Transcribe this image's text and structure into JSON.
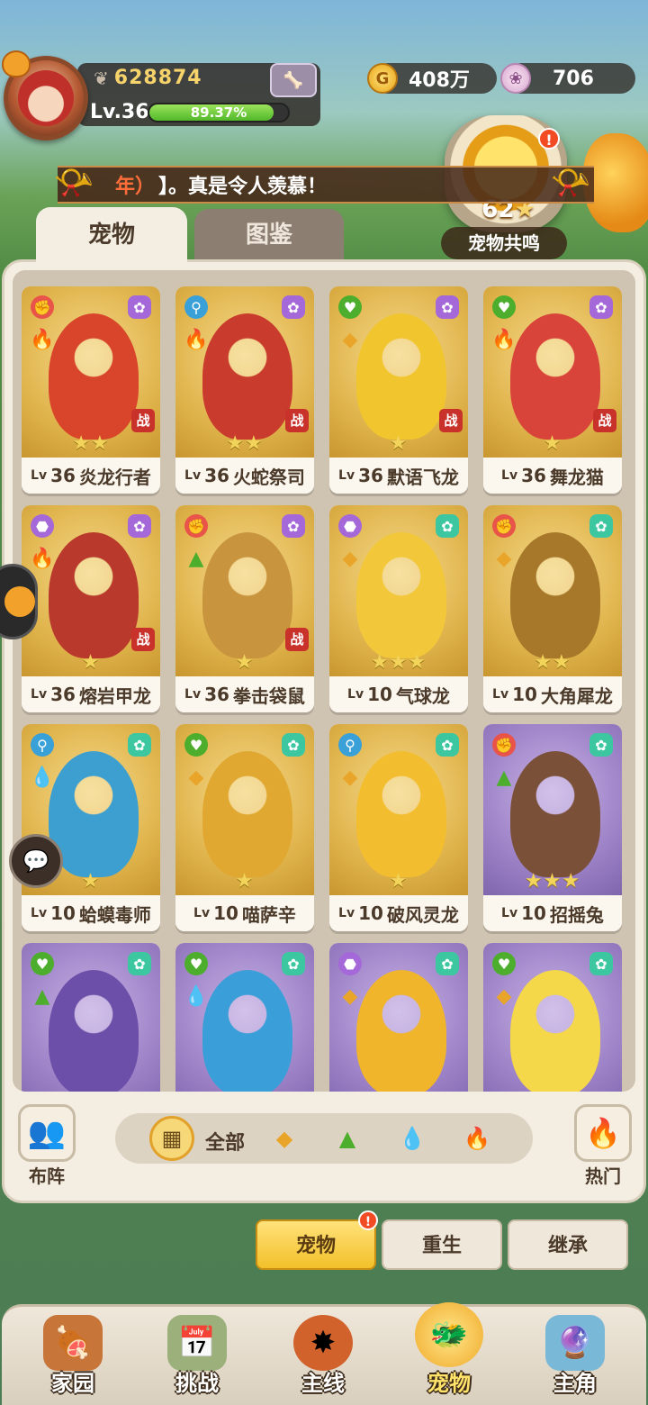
{
  "player": {
    "combat_power": "628874",
    "level": "Lv.36",
    "exp_percent": "89.37%",
    "exp_fraction": 0.8937
  },
  "currency": {
    "gold": "408万",
    "shells": "706"
  },
  "broadcast": {
    "highlight": "年）",
    "message": "】。真是令人羡慕！"
  },
  "resonance": {
    "badge": "!",
    "value": "62",
    "star": "★",
    "label": "宠物共鸣"
  },
  "tabs": {
    "pets": "宠物",
    "codex": "图鉴"
  },
  "pets": [
    {
      "level": "36",
      "name": "炎龙行者",
      "stars": "★★",
      "rarity": "gold",
      "color": "#d8452a",
      "tag": "战",
      "element": "fire"
    },
    {
      "level": "36",
      "name": "火蛇祭司",
      "stars": "★★",
      "rarity": "gold",
      "color": "#c93b2c",
      "tag": "战",
      "element": "fire"
    },
    {
      "level": "36",
      "name": "默语飞龙",
      "stars": "★",
      "rarity": "gold",
      "color": "#f1c52e",
      "tag": "战",
      "element": "earth"
    },
    {
      "level": "36",
      "name": "舞龙猫",
      "stars": "★",
      "rarity": "gold",
      "color": "#d9443a",
      "tag": "战",
      "element": "fire"
    },
    {
      "level": "36",
      "name": "熔岩甲龙",
      "stars": "★",
      "rarity": "gold",
      "color": "#b93a2c",
      "tag": "战",
      "element": "fire"
    },
    {
      "level": "36",
      "name": "拳击袋鼠",
      "stars": "★",
      "rarity": "gold",
      "color": "#c8953e",
      "tag": "战",
      "element": "grass"
    },
    {
      "level": "10",
      "name": "气球龙",
      "stars": "★★★",
      "rarity": "gold",
      "color": "#f2c73a",
      "tag": "",
      "element": "earth"
    },
    {
      "level": "10",
      "name": "大角犀龙",
      "stars": "★★",
      "rarity": "gold",
      "color": "#a7782a",
      "tag": "",
      "element": "earth"
    },
    {
      "level": "10",
      "name": "蛤蟆毒师",
      "stars": "★",
      "rarity": "gold",
      "color": "#3d9fd0",
      "tag": "",
      "element": "water"
    },
    {
      "level": "10",
      "name": "喵萨辛",
      "stars": "★",
      "rarity": "gold",
      "color": "#e0a830",
      "tag": "",
      "element": "earth"
    },
    {
      "level": "10",
      "name": "破风灵龙",
      "stars": "★",
      "rarity": "gold",
      "color": "#f2bd2e",
      "tag": "",
      "element": "earth"
    },
    {
      "level": "10",
      "name": "招摇兔",
      "stars": "★★★",
      "rarity": "purple",
      "color": "#7a5038",
      "tag": "",
      "element": "grass"
    },
    {
      "level": "",
      "name": "",
      "stars": "",
      "rarity": "purple",
      "color": "#6b4fa8",
      "tag": "",
      "element": "grass"
    },
    {
      "level": "",
      "name": "",
      "stars": "",
      "rarity": "purple",
      "color": "#3a9fd8",
      "tag": "",
      "element": "water"
    },
    {
      "level": "",
      "name": "",
      "stars": "",
      "rarity": "purple",
      "color": "#f0b52a",
      "tag": "",
      "element": "earth"
    },
    {
      "level": "",
      "name": "",
      "stars": "",
      "rarity": "purple",
      "color": "#f4d84a",
      "tag": "",
      "element": "earth"
    }
  ],
  "filters": {
    "formation": "布阵",
    "all": "全部",
    "hot": "热门"
  },
  "sub_tabs": {
    "pets": "宠物",
    "rebirth": "重生",
    "inherit": "继承",
    "badge": "!"
  },
  "nav": {
    "home": "家园",
    "challenge": "挑战",
    "main_line": "主线",
    "pets": "宠物",
    "hero": "主角"
  }
}
